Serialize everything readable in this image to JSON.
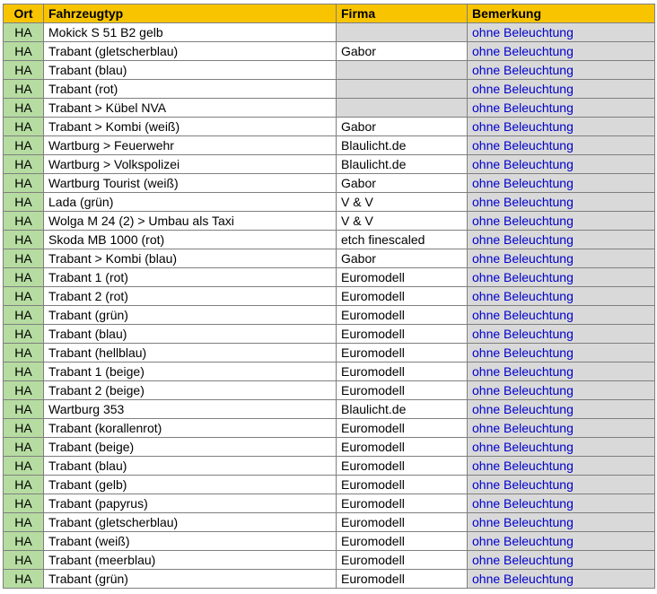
{
  "table": {
    "headers": {
      "ort": "Ort",
      "typ": "Fahrzeugtyp",
      "firma": "Firma",
      "bem": "Bemerkung"
    },
    "rows": [
      {
        "ort": "HA",
        "typ": "Mokick S 51 B2 gelb",
        "firma": "",
        "bem": "ohne Beleuchtung"
      },
      {
        "ort": "HA",
        "typ": "Trabant (gletscherblau)",
        "firma": "Gabor",
        "bem": "ohne Beleuchtung"
      },
      {
        "ort": "HA",
        "typ": "Trabant (blau)",
        "firma": "",
        "bem": "ohne Beleuchtung"
      },
      {
        "ort": "HA",
        "typ": "Trabant (rot)",
        "firma": "",
        "bem": "ohne Beleuchtung"
      },
      {
        "ort": "HA",
        "typ": "Trabant > Kübel NVA",
        "firma": "",
        "bem": "ohne Beleuchtung"
      },
      {
        "ort": "HA",
        "typ": "Trabant > Kombi (weiß)",
        "firma": "Gabor",
        "bem": "ohne Beleuchtung"
      },
      {
        "ort": "HA",
        "typ": "Wartburg > Feuerwehr",
        "firma": "Blaulicht.de",
        "bem": "ohne Beleuchtung"
      },
      {
        "ort": "HA",
        "typ": "Wartburg > Volkspolizei",
        "firma": "Blaulicht.de",
        "bem": "ohne Beleuchtung"
      },
      {
        "ort": "HA",
        "typ": "Wartburg Tourist (weiß)",
        "firma": "Gabor",
        "bem": "ohne Beleuchtung"
      },
      {
        "ort": "HA",
        "typ": "Lada (grün)",
        "firma": "V & V",
        "bem": "ohne Beleuchtung"
      },
      {
        "ort": "HA",
        "typ": "Wolga M 24 (2) > Umbau als Taxi",
        "firma": "V & V",
        "bem": "ohne Beleuchtung"
      },
      {
        "ort": "HA",
        "typ": "Skoda MB 1000 (rot)",
        "firma": "etch finescaled",
        "bem": "ohne Beleuchtung"
      },
      {
        "ort": "HA",
        "typ": "Trabant > Kombi (blau)",
        "firma": "Gabor",
        "bem": "ohne Beleuchtung"
      },
      {
        "ort": "HA",
        "typ": "Trabant 1 (rot)",
        "firma": "Euromodell",
        "bem": "ohne Beleuchtung"
      },
      {
        "ort": "HA",
        "typ": "Trabant 2 (rot)",
        "firma": "Euromodell",
        "bem": "ohne Beleuchtung"
      },
      {
        "ort": "HA",
        "typ": "Trabant (grün)",
        "firma": "Euromodell",
        "bem": "ohne Beleuchtung"
      },
      {
        "ort": "HA",
        "typ": "Trabant (blau)",
        "firma": "Euromodell",
        "bem": "ohne Beleuchtung"
      },
      {
        "ort": "HA",
        "typ": "Trabant (hellblau)",
        "firma": "Euromodell",
        "bem": "ohne Beleuchtung"
      },
      {
        "ort": "HA",
        "typ": "Trabant 1 (beige)",
        "firma": "Euromodell",
        "bem": "ohne Beleuchtung"
      },
      {
        "ort": "HA",
        "typ": "Trabant 2 (beige)",
        "firma": "Euromodell",
        "bem": "ohne Beleuchtung"
      },
      {
        "ort": "HA",
        "typ": "Wartburg 353",
        "firma": "Blaulicht.de",
        "bem": "ohne Beleuchtung"
      },
      {
        "ort": "HA",
        "typ": "Trabant (korallenrot)",
        "firma": "Euromodell",
        "bem": "ohne Beleuchtung"
      },
      {
        "ort": "HA",
        "typ": "Trabant (beige)",
        "firma": "Euromodell",
        "bem": "ohne Beleuchtung"
      },
      {
        "ort": "HA",
        "typ": "Trabant (blau)",
        "firma": "Euromodell",
        "bem": "ohne Beleuchtung"
      },
      {
        "ort": "HA",
        "typ": "Trabant (gelb)",
        "firma": "Euromodell",
        "bem": "ohne Beleuchtung"
      },
      {
        "ort": "HA",
        "typ": "Trabant (papyrus)",
        "firma": "Euromodell",
        "bem": "ohne Beleuchtung"
      },
      {
        "ort": "HA",
        "typ": "Trabant (gletscherblau)",
        "firma": "Euromodell",
        "bem": "ohne Beleuchtung"
      },
      {
        "ort": "HA",
        "typ": "Trabant (weiß)",
        "firma": "Euromodell",
        "bem": "ohne Beleuchtung"
      },
      {
        "ort": "HA",
        "typ": "Trabant (meerblau)",
        "firma": "Euromodell",
        "bem": "ohne Beleuchtung"
      },
      {
        "ort": "HA",
        "typ": "Trabant (grün)",
        "firma": "Euromodell",
        "bem": "ohne Beleuchtung"
      }
    ]
  },
  "colors": {
    "header_bg": "#f8c400",
    "ort_bg": "#b6dca1",
    "remark_bg": "#d9d9d9",
    "remark_text": "#0000cc",
    "border": "#7f7f7f"
  }
}
